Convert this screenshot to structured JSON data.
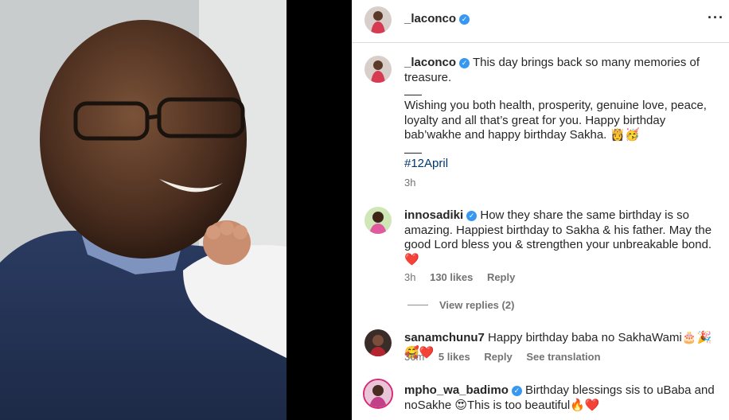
{
  "post": {
    "author": "_laconco",
    "caption_line1": "This day brings back so many memories of treasure.",
    "caption_line2": "Wishing you both health, prosperity, genuine love, peace, loyalty and all that’s great for you. Happy birthday bab’wakhe and happy birthday Sakha. 👸🥳",
    "hashtag": "#12April",
    "time": "3h"
  },
  "comments": [
    {
      "username": "innosadiki",
      "verified": true,
      "text": "How they share the same birthday is so amazing. Happiest birthday to Sakha & his father. May the good Lord bless you & strengthen your unbreakable bond. ❤️",
      "time": "3h",
      "likes": "130 likes",
      "reply": "Reply",
      "view_replies": "View replies (2)"
    },
    {
      "username": "sanamchunu7",
      "verified": false,
      "text": "Happy birthday baba no SakhaWami🎂🎉🥰❤️",
      "time": "36m",
      "likes": "5 likes",
      "reply": "Reply",
      "translation": "See translation"
    },
    {
      "username": "mpho_wa_badimo",
      "verified": true,
      "text": "Birthday blessings sis to uBaba and noSakhe 😍This is too beautiful🔥❤️"
    }
  ],
  "icons": {
    "verified": "verified-badge-icon",
    "more": "more-options-icon"
  },
  "colors": {
    "verified": "#3897f0",
    "hashtag": "#00376b",
    "meta": "#737373"
  }
}
